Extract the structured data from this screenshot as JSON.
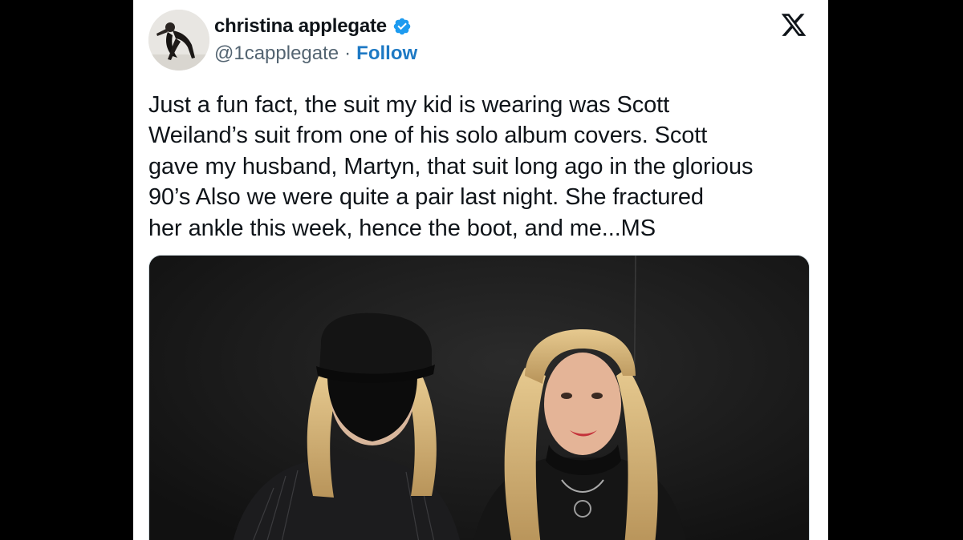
{
  "tweet": {
    "author": {
      "display_name": "christina applegate",
      "handle": "@1capplegate",
      "verified": true,
      "separator": "·",
      "follow_label": "Follow"
    },
    "platform_icon": "x-logo-icon",
    "text": "Just a fun fact, the suit my kid is wearing was Scott\nWeiland’s suit from one of his solo album covers. Scott\ngave my husband, Martyn, that suit long ago in the glorious\n90’s    Also we were quite a pair last night. She fractured\nher ankle this week, hence the boot, and me...MS",
    "media": {
      "type": "photo"
    }
  },
  "colors": {
    "background": "#000000",
    "card": "#ffffff",
    "text": "#0f1419",
    "secondary_text": "#536471",
    "link": "#1d79c4",
    "verified_badge": "#1d9bf0"
  }
}
